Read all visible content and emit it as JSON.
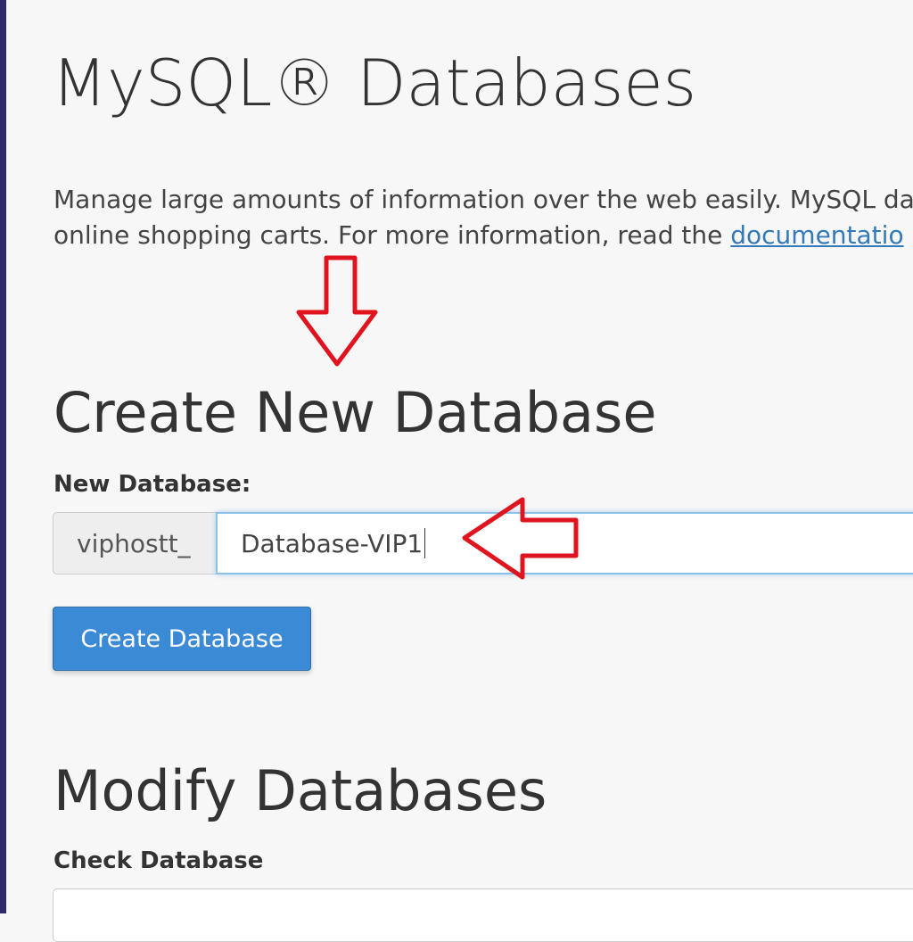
{
  "page": {
    "title": "MySQL® Databases",
    "description_line1": "Manage large amounts of information over the web easily. MySQL da",
    "description_line2_prefix": "online shopping carts. For more information, read the ",
    "documentation_link": "documentatio"
  },
  "create_section": {
    "title": "Create New Database",
    "new_db_label": "New Database:",
    "prefix": "viphostt_",
    "db_name_value": "Database-VIP1",
    "create_button_label": "Create Database"
  },
  "modify_section": {
    "title": "Modify Databases",
    "check_db_label": "Check Database"
  },
  "colors": {
    "accent": "#3b8ad6",
    "link": "#337ab7",
    "annotation_arrow": "#e0141e",
    "left_edge": "#2d2b6b"
  },
  "annotations": {
    "arrow_down_icon": "arrow-down-outline",
    "arrow_left_icon": "arrow-left-outline"
  }
}
